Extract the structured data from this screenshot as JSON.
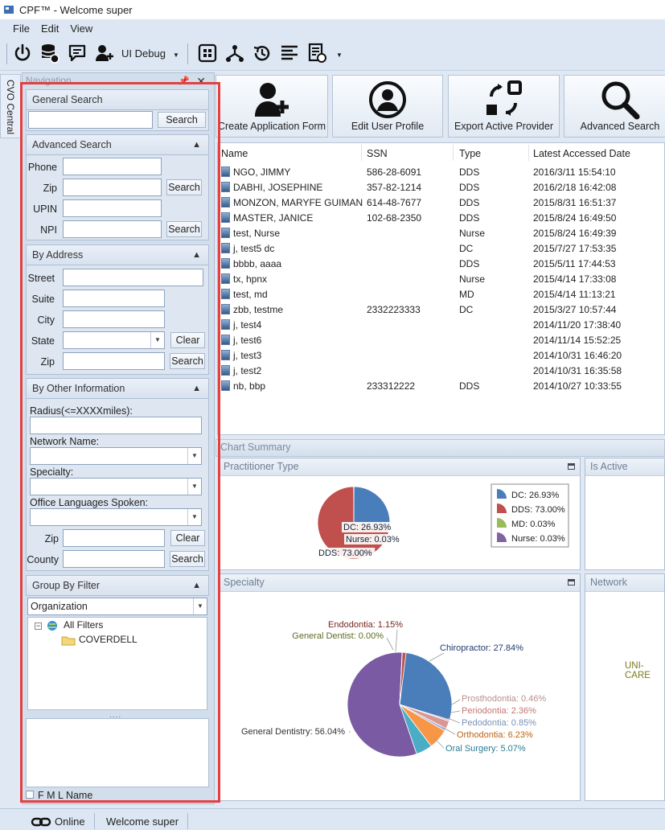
{
  "window": {
    "title": "CPF™ - Welcome super"
  },
  "menu": [
    "File",
    "Edit",
    "View"
  ],
  "toolbar": {
    "ui_debug_label": "UI Debug"
  },
  "cvo_tab": "CVO Central",
  "navigation": {
    "title": "Navigation",
    "general_search": {
      "header": "General Search",
      "button": "Search",
      "value": ""
    },
    "advanced_search": {
      "header": "Advanced Search",
      "phone_label": "Phone",
      "zip_label": "Zip",
      "upin_label": "UPIN",
      "npi_label": "NPI",
      "search_btn": "Search"
    },
    "by_address": {
      "header": "By Address",
      "street_label": "Street",
      "suite_label": "Suite",
      "city_label": "City",
      "state_label": "State",
      "zip_label": "Zip",
      "clear_btn": "Clear",
      "search_btn": "Search"
    },
    "by_other": {
      "header": "By Other Information",
      "radius_label": "Radius(<=XXXXmiles):",
      "network_label": "Network Name:",
      "specialty_label": "Specialty:",
      "languages_label": "Office Languages Spoken:",
      "zip_label": "Zip",
      "county_label": "County",
      "clear_btn": "Clear",
      "search_btn": "Search"
    },
    "group_by": {
      "header": "Group By Filter",
      "selected": "Organization",
      "tree_root": "All Filters",
      "tree_child": "COVERDELL",
      "splitter": "....",
      "fml_label": "F M L Name"
    }
  },
  "actions": [
    {
      "label": "Create Application Form",
      "icon": "add-user-icon"
    },
    {
      "label": "Edit User Profile",
      "icon": "user-profile-icon"
    },
    {
      "label": "Export Active Provider",
      "icon": "export-icon"
    },
    {
      "label": "Advanced Search",
      "icon": "magnifier-icon"
    }
  ],
  "table": {
    "headers": [
      "Name",
      "SSN",
      "Type",
      "Latest Accessed Date"
    ],
    "rows": [
      [
        "NGO, JIMMY",
        "586-28-6091",
        "DDS",
        "2016/3/11 15:54:10"
      ],
      [
        "DABHI, JOSEPHINE",
        "357-82-1214",
        "DDS",
        "2016/2/18 16:42:08"
      ],
      [
        "MONZON, MARYFE GUIMAN",
        "614-48-7677",
        "DDS",
        "2015/8/31 16:51:37"
      ],
      [
        "MASTER, JANICE",
        "102-68-2350",
        "DDS",
        "2015/8/24 16:49:50"
      ],
      [
        "test, Nurse",
        "",
        "Nurse",
        "2015/8/24 16:49:39"
      ],
      [
        "j, test5 dc",
        "",
        "DC",
        "2015/7/27 17:53:35"
      ],
      [
        "bbbb, aaaa",
        "",
        "DDS",
        "2015/5/11 17:44:53"
      ],
      [
        "tx, hpnx",
        "",
        "Nurse",
        "2015/4/14 17:33:08"
      ],
      [
        "test, md",
        "",
        "MD",
        "2015/4/14 11:13:21"
      ],
      [
        "zbb, testme",
        "2332223333",
        "DC",
        "2015/3/27 10:57:44"
      ],
      [
        "j, test4",
        "",
        "",
        "2014/11/20 17:38:40"
      ],
      [
        "j, test6",
        "",
        "",
        "2014/11/14 15:52:25"
      ],
      [
        "j, test3",
        "",
        "",
        "2014/10/31 16:46:20"
      ],
      [
        "j, test2",
        "",
        "",
        "2014/10/31 16:35:58"
      ],
      [
        "nb, bbp",
        "233312222",
        "DDS",
        "2014/10/27 10:33:55"
      ]
    ]
  },
  "chart_summary": {
    "title": "Chart Summary",
    "panels": {
      "practitioner": "Practitioner Type",
      "is_active": "Is Active",
      "specialty": "Specialty",
      "network": "Network"
    },
    "network_label": "UNI-CARE"
  },
  "chart_data": [
    {
      "type": "pie",
      "title": "Practitioner Type",
      "categories": [
        "DC",
        "DDS",
        "MD",
        "Nurse"
      ],
      "values": [
        26.93,
        73.0,
        0.03,
        0.03
      ],
      "colors": [
        "#4a7ebb",
        "#c0504d",
        "#9bbb59",
        "#8064a2"
      ],
      "slice_labels": [
        "DC: 26.93%",
        "Nurse: 0.03%",
        "DDS: 73.00%"
      ],
      "legend": [
        "DC: 26.93%",
        "DDS: 73.00%",
        "MD: 0.03%",
        "Nurse: 0.03%"
      ],
      "legend_position": "right"
    },
    {
      "type": "pie",
      "title": "Specialty",
      "categories": [
        "Chiropractor",
        "Prosthodontia",
        "Periodontia",
        "Pedodontia",
        "Orthodontia",
        "Oral Surgery",
        "General Dentistry",
        "General Dentist",
        "Endodontia"
      ],
      "values": [
        27.84,
        0.46,
        2.36,
        0.85,
        6.23,
        5.07,
        56.04,
        0.0,
        1.15
      ],
      "colors": [
        "#4a7ebb",
        "#d9a7a6",
        "#d99694",
        "#a3b6d9",
        "#f79646",
        "#4bacc6",
        "#7a5aa2",
        "#8fa24d",
        "#c0504d"
      ],
      "labels": [
        "Chiropractor: 27.84%",
        "Prosthodontia: 0.46%",
        "Periodontia: 2.36%",
        "Pedodontia: 0.85%",
        "Orthodontia: 6.23%",
        "Oral Surgery: 5.07%",
        "General Dentistry: 56.04%",
        "General Dentist: 0.00%",
        "Endodontia: 1.15%"
      ]
    }
  ],
  "status": {
    "online": "Online",
    "welcome": "Welcome super"
  }
}
